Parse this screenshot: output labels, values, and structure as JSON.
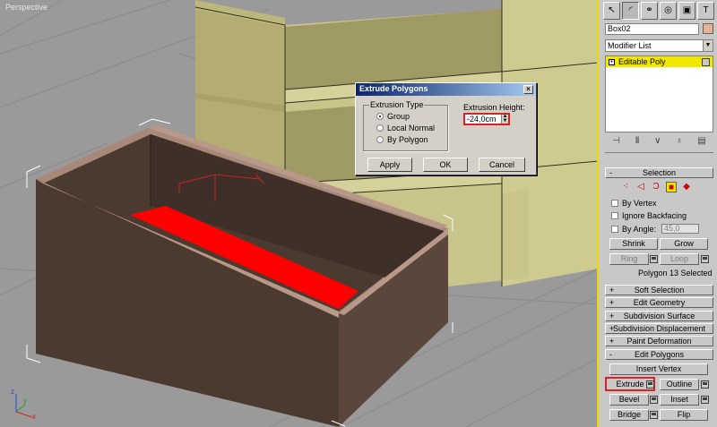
{
  "viewport": {
    "label": "Perspective"
  },
  "dialog": {
    "title": "Extrude Polygons",
    "close_glyph": "×",
    "extrusion_type_label": "Extrusion Type",
    "options": [
      "Group",
      "Local Normal",
      "By Polygon"
    ],
    "selected_option": "Group",
    "height_label": "Extrusion Height:",
    "height_value": "-24,0cm",
    "apply_label": "Apply",
    "ok_label": "OK",
    "cancel_label": "Cancel"
  },
  "panel": {
    "tabs": [
      "create-icon",
      "modify-icon",
      "hierarchy-icon",
      "motion-icon",
      "display-icon",
      "utilities-icon"
    ],
    "object_name": "Box02",
    "object_color": "#e8b090",
    "modifier_list_label": "Modifier List",
    "stack_item": "Editable Poly",
    "selection": {
      "header": "Selection",
      "by_vertex": "By Vertex",
      "ignore_backfacing": "Ignore Backfacing",
      "by_angle": "By Angle:",
      "angle_value": "45,0",
      "shrink": "Shrink",
      "grow": "Grow",
      "ring": "Ring",
      "loop": "Loop",
      "status": "Polygon 13 Selected"
    },
    "rollouts": [
      "Soft Selection",
      "Edit Geometry",
      "Subdivision Surface",
      "Subdivision Displacement",
      "Paint Deformation"
    ],
    "edit_polygons": {
      "header": "Edit Polygons",
      "insert_vertex": "Insert Vertex",
      "extrude": "Extrude",
      "outline": "Outline",
      "bevel": "Bevel",
      "inset": "Inset",
      "bridge": "Bridge",
      "flip": "Flip"
    }
  },
  "colors": {
    "selection_red": "#ff0000",
    "active_yellow": "#f0e800",
    "shelf": "#c9c48a",
    "box": "#4a3a30"
  }
}
